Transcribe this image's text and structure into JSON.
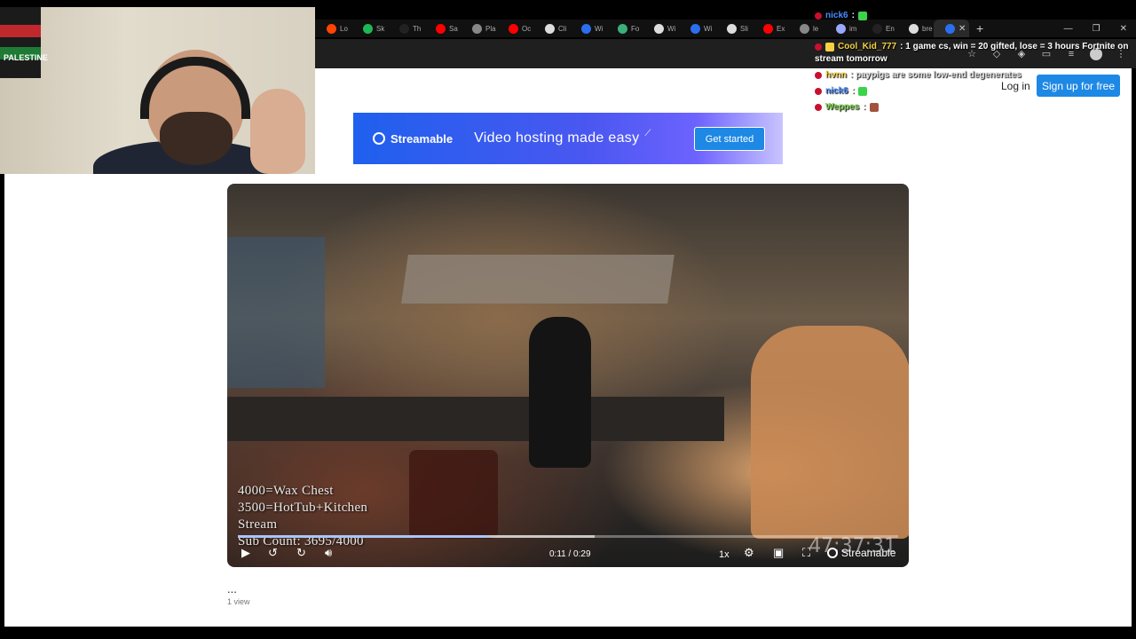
{
  "browser": {
    "tabs": [
      {
        "label": "Lo",
        "icon": "reddit-icon",
        "color": "#ff4500"
      },
      {
        "label": "Sk",
        "icon": "spotify-icon",
        "color": "#1db954"
      },
      {
        "label": "Th",
        "icon": "tiktok-icon",
        "color": "#222222"
      },
      {
        "label": "Sa",
        "icon": "youtube-icon",
        "color": "#ff0000"
      },
      {
        "label": "Pla",
        "icon": "globe-icon",
        "color": "#888888"
      },
      {
        "label": "Oc",
        "icon": "youtube-icon",
        "color": "#ff0000"
      },
      {
        "label": "Cli",
        "icon": "x-icon",
        "color": "#dddddd"
      },
      {
        "label": "Wi",
        "icon": "streamable-icon",
        "color": "#2b6ff0"
      },
      {
        "label": "Fo",
        "icon": "globe-icon",
        "color": "#3ab07a"
      },
      {
        "label": "Wi",
        "icon": "wikipedia-icon",
        "color": "#dddddd"
      },
      {
        "label": "Wi",
        "icon": "streamable-icon",
        "color": "#2b6ff0"
      },
      {
        "label": "Sli",
        "icon": "x-icon",
        "color": "#dddddd"
      },
      {
        "label": "Ex",
        "icon": "youtube-icon",
        "color": "#ff0000"
      },
      {
        "label": "le",
        "icon": "globe-icon",
        "color": "#888888"
      },
      {
        "label": "im",
        "icon": "imdb-icon",
        "color": "#9aa8ff"
      },
      {
        "label": "En",
        "icon": "tiktok-icon",
        "color": "#222222"
      },
      {
        "label": "bre",
        "icon": "x-icon",
        "color": "#dddddd"
      }
    ],
    "new_tab": "+",
    "close": "✕"
  },
  "page": {
    "login": "Log in",
    "signup": "Sign up for free",
    "banner": {
      "brand": "Streamable",
      "tagline": "Video hosting made easy",
      "cta": "Get started"
    },
    "title": "...",
    "views": "1 view"
  },
  "video": {
    "overlay_lines": [
      "4000=Wax Chest",
      "3500=HotTub+Kitchen",
      "Stream",
      "Sub Count: 3695/4000"
    ],
    "time": "0:11 / 0:29",
    "speed": "1x",
    "brand": "Streamable",
    "counter": "47:37:31",
    "progress": 0.38,
    "buffered": 0.54
  },
  "webcam": {
    "poster_text": "PALESTINE"
  },
  "chat": [
    {
      "user": "nick6",
      "msg": ":",
      "color": "#4a8cff"
    },
    {
      "user": "Cool_Kid_777",
      "msg": ": 1 game cs, win = 20 gifted, lose = 3 hours Fortnite on",
      "color": "#f5d142"
    },
    {
      "user": "",
      "msg": "stream tomorrow",
      "color": "#ffffff"
    },
    {
      "user": "hvnn",
      "msg": ": paypigs are some low-end degenerates",
      "color": "#f5d142"
    },
    {
      "user": "nick6",
      "msg": ":",
      "color": "#4a8cff"
    },
    {
      "user": "Weppes",
      "msg": ":",
      "color": "#7ccf4c"
    }
  ]
}
